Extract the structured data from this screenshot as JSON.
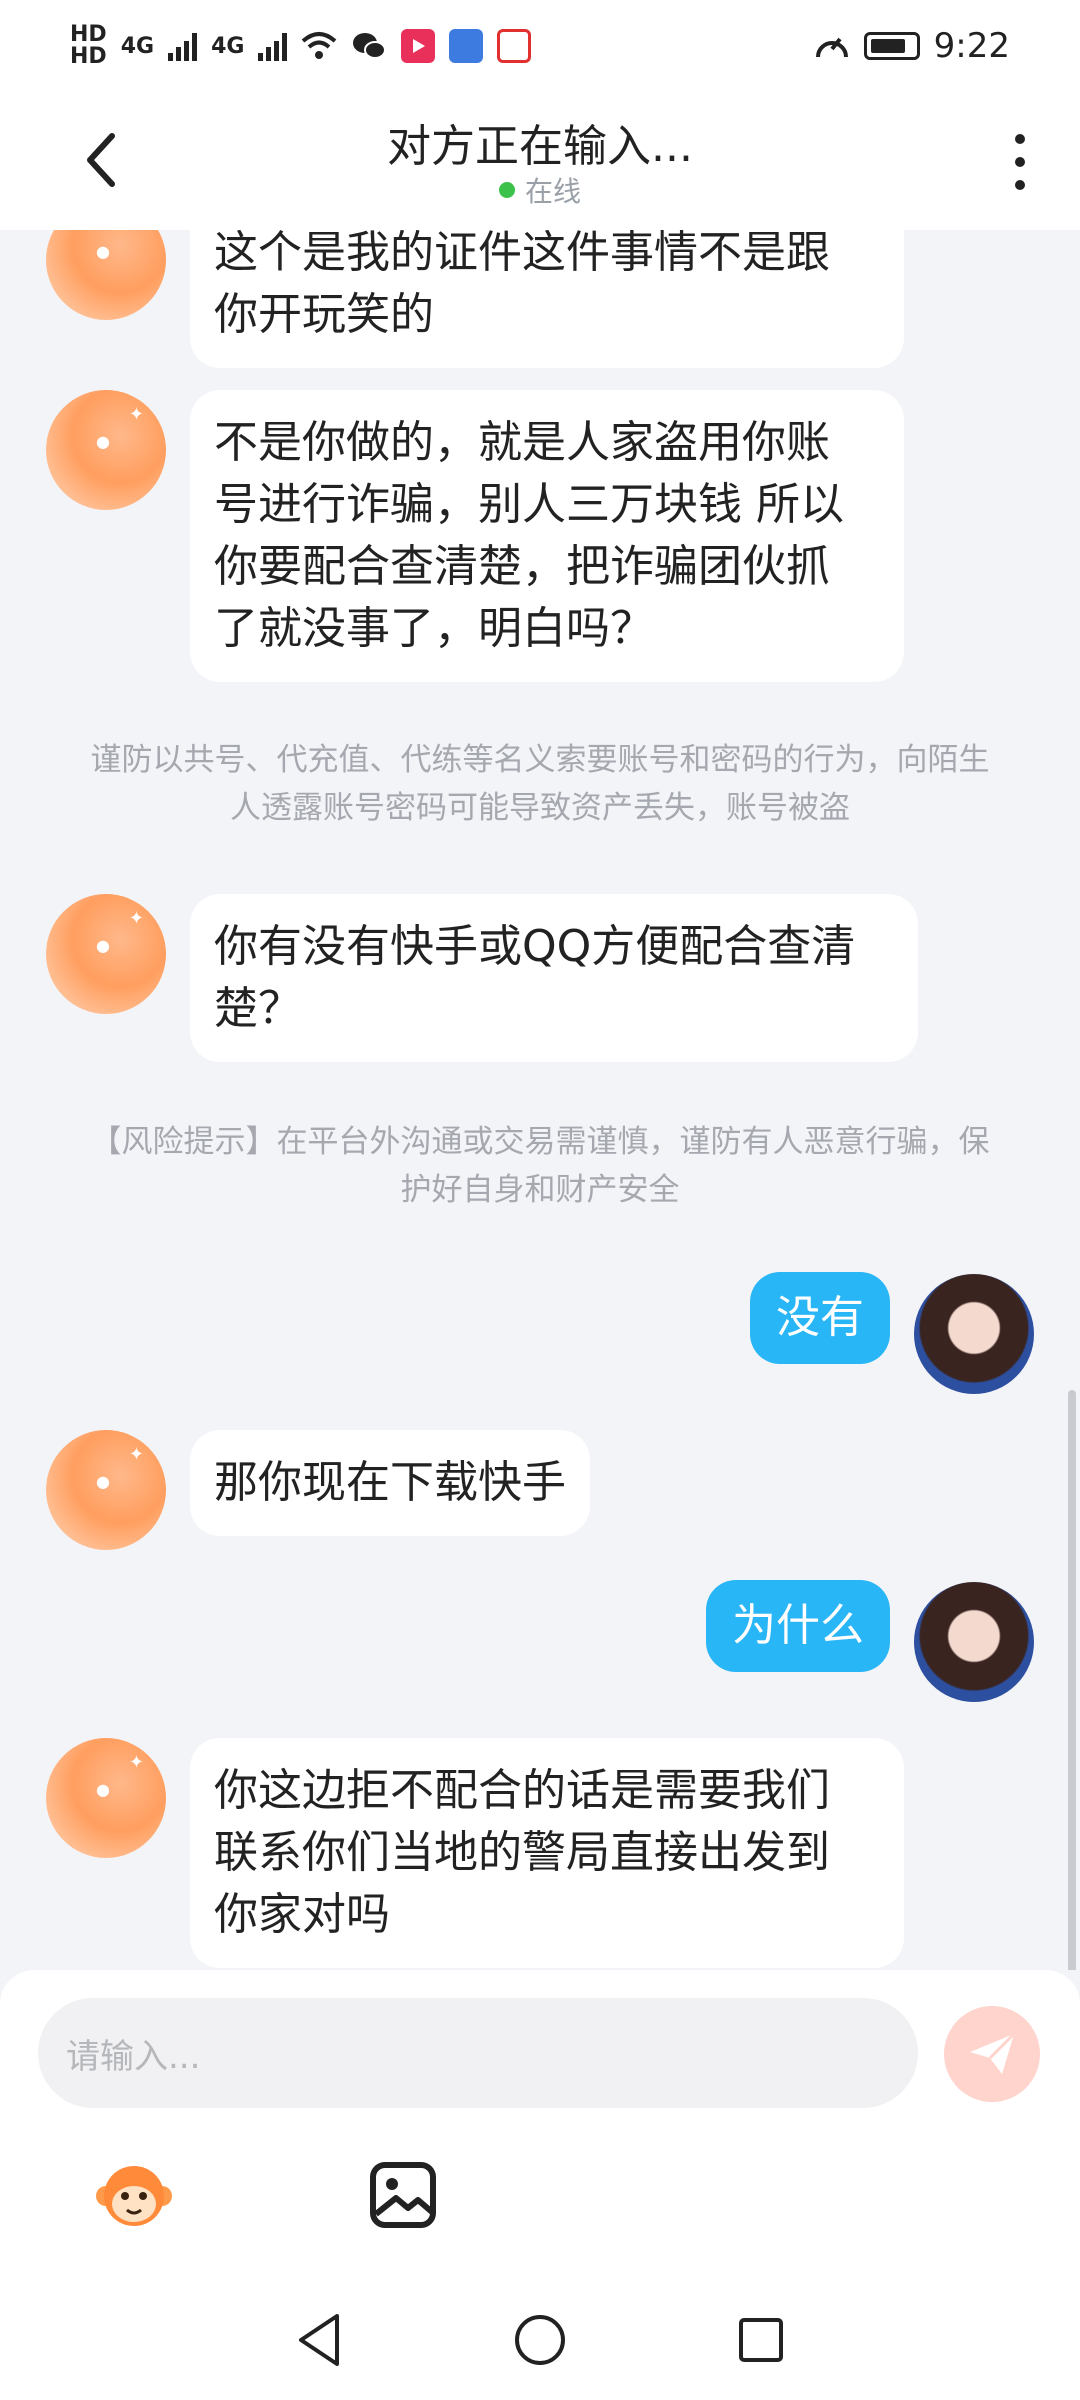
{
  "status_bar": {
    "hd1": "HD",
    "hd2": "HD",
    "net1": "4G",
    "net2": "4G",
    "time": "9:22"
  },
  "header": {
    "title": "对方正在输入...",
    "status": "在线"
  },
  "messages": [
    {
      "text": "这个是我的证件这件事情不是跟\n你开玩笑的"
    },
    {
      "text": "不是你做的，就是人家盗用你账\n号进行诈骗，别人三万块钱 所以\n你要配合查清楚，把诈骗团伙抓\n了就没事了，明白吗？"
    },
    {
      "notice": "谨防以共号、代充值、代练等名义索要账号和密码的行为，向陌生人透露账号密码可能导致资产丢失，账号被盗"
    },
    {
      "text": "你有没有快手或QQ方便配合查清\n楚？"
    },
    {
      "notice": "【风险提示】在平台外沟通或交易需谨慎，谨防有人恶意行骗，保护好自身和财产安全"
    },
    {
      "text": "没有"
    },
    {
      "text": "那你现在下载快手"
    },
    {
      "text": "为什么"
    },
    {
      "text": "你这边拒不配合的话是需要我们\n联系你们当地的警局直接出发到\n你家对吗"
    }
  ],
  "input": {
    "placeholder": "请输入..."
  },
  "icons": {
    "back": "back-arrow-icon",
    "more": "more-vertical-icon",
    "send": "paper-plane-icon",
    "emoji": "monkey-sticker-icon",
    "image": "image-icon",
    "nav_back": "triangle-back-icon",
    "nav_home": "circle-home-icon",
    "nav_recent": "square-recent-icon"
  },
  "colors": {
    "accent_blue": "#29b6f6",
    "online_green": "#3cc24a",
    "send_disabled": "#ffd4cc",
    "bubble_in": "#ffffff",
    "background": "#f3f4f8"
  }
}
